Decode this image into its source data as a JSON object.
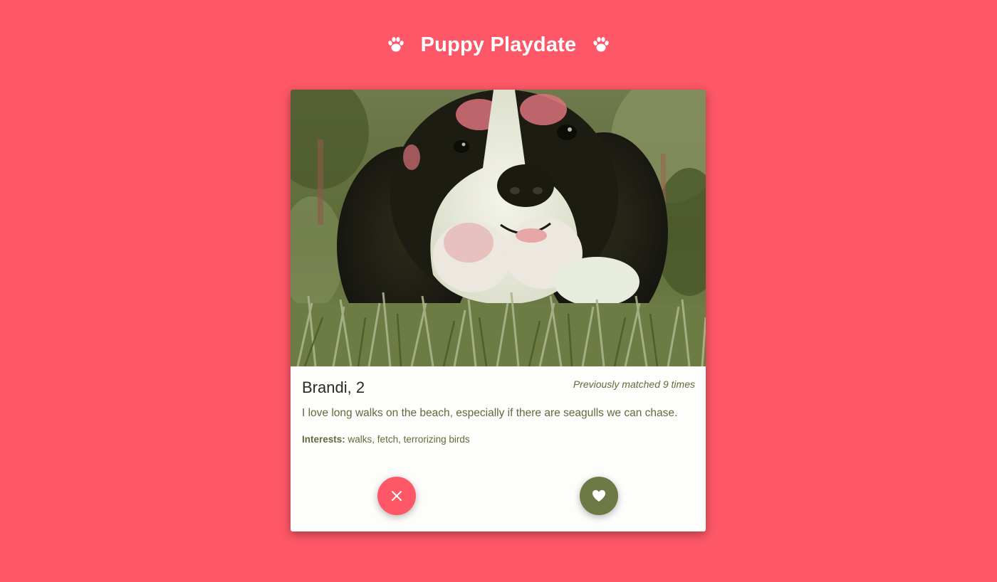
{
  "app": {
    "title": "Puppy Playdate"
  },
  "profile": {
    "name_age": "Brandi, 2",
    "match_count_text": "Previously matched 9 times",
    "bio": "I love long walks on the beach, especially if there are seagulls we can chase.",
    "interests_label": "Interests:",
    "interests": "walks, fetch, terrorizing birds",
    "photo": "dog-photo"
  },
  "actions": {
    "pass_icon": "close-icon",
    "like_icon": "heart-icon"
  },
  "colors": {
    "background": "#fe5868",
    "accent_pass": "#fe5868",
    "accent_like": "#6e7a45",
    "text_olive": "#5f6b3a",
    "card": "#fdfdfb"
  }
}
